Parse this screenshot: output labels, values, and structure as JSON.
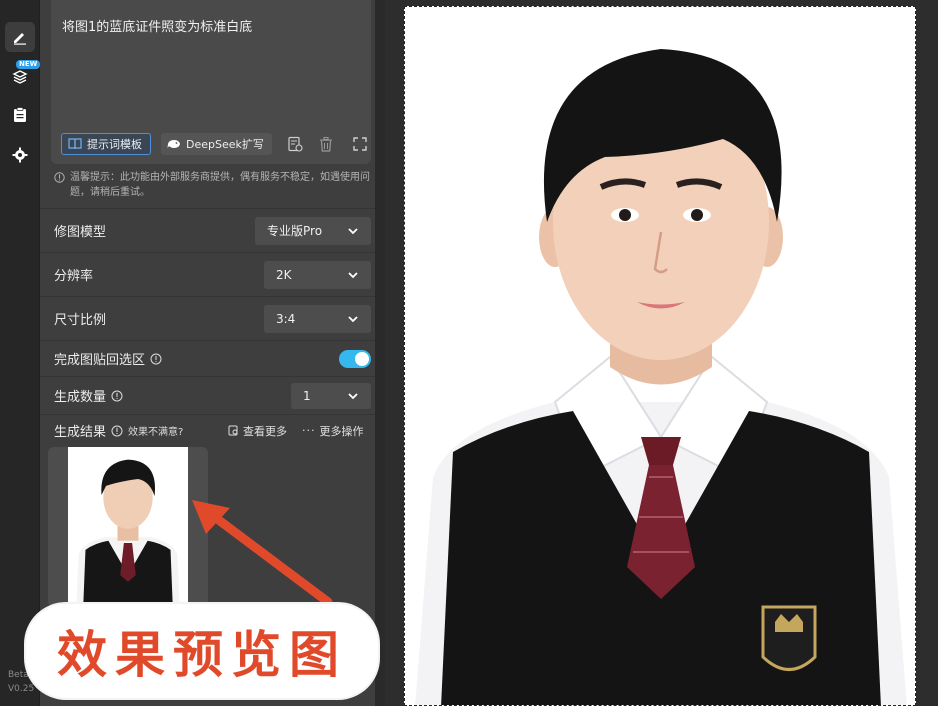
{
  "rail": {
    "items": [
      {
        "name": "edit-icon",
        "active": true
      },
      {
        "name": "layers-icon",
        "badge": "NEW"
      },
      {
        "name": "clipboard-icon"
      },
      {
        "name": "gear-icon"
      }
    ],
    "version_line1": "Beta",
    "version_line2": "V0.25"
  },
  "prompt": {
    "text": "将图1的蓝底证件照变为标准白底",
    "template_button": "提示词模板",
    "deepseek_button": "DeepSeek扩写"
  },
  "notice": "温馨提示：此功能由外部服务商提供，偶有服务不稳定，如遇使用问题，请稍后重试。",
  "settings": {
    "model": {
      "label": "修图模型",
      "value": "专业版Pro"
    },
    "resolution": {
      "label": "分辨率",
      "value": "2K"
    },
    "ratio": {
      "label": "尺寸比例",
      "value": "3:4"
    },
    "paste_back": {
      "label": "完成图贴回选区",
      "enabled": true
    },
    "count": {
      "label": "生成数量",
      "value": "1"
    }
  },
  "results": {
    "label": "生成结果",
    "unsatisfied": "效果不满意?",
    "view_more": "查看更多",
    "more_actions": "更多操作"
  },
  "overlay": {
    "caption": "效果预览图",
    "arrow_color": "#e04a2a"
  },
  "colors": {
    "accent": "#35b8ee",
    "panel_bg": "#3e3e3e",
    "template_border": "#4f8ed8"
  }
}
